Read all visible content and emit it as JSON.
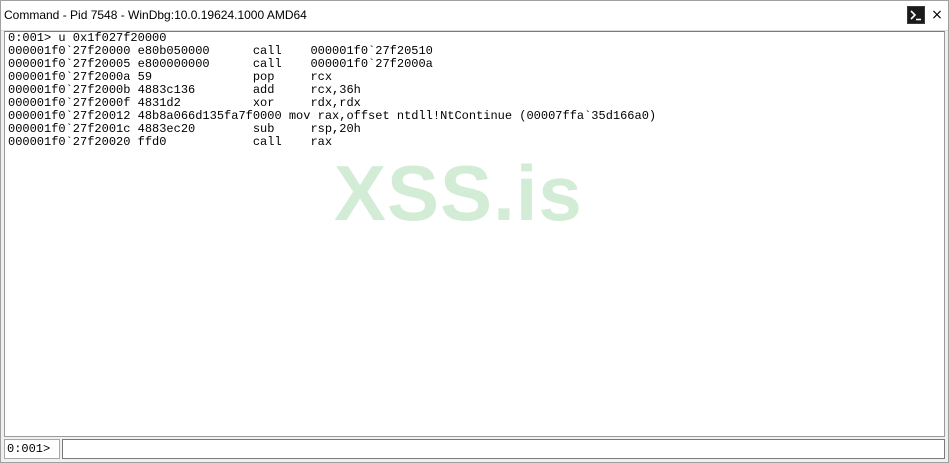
{
  "window": {
    "title": "Command - Pid 7548 - WinDbg:10.0.19624.1000 AMD64",
    "cmd_button_icon": "console-prompt-icon",
    "close_glyph": "×"
  },
  "output": {
    "lines": [
      "0:001> u 0x1f027f20000",
      "000001f0`27f20000 e80b050000      call    000001f0`27f20510",
      "000001f0`27f20005 e800000000      call    000001f0`27f2000a",
      "000001f0`27f2000a 59              pop     rcx",
      "000001f0`27f2000b 4883c136        add     rcx,36h",
      "000001f0`27f2000f 4831d2          xor     rdx,rdx",
      "000001f0`27f20012 48b8a066d135fa7f0000 mov rax,offset ntdll!NtContinue (00007ffa`35d166a0)",
      "000001f0`27f2001c 4883ec20        sub     rsp,20h",
      "000001f0`27f20020 ffd0            call    rax"
    ],
    "watermark": "XSS.is"
  },
  "command_bar": {
    "prompt": "0:001>",
    "input_value": ""
  }
}
